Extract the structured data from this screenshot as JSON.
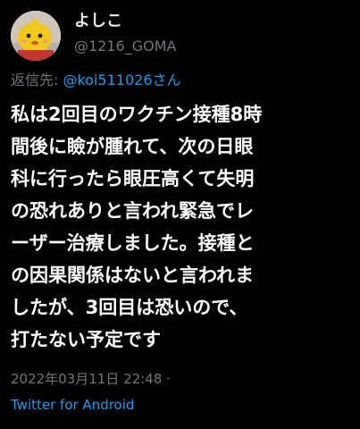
{
  "author": {
    "display_name": "よしこ",
    "handle": "@1216_GOMA",
    "avatar_icon": "yellow-character-avatar-icon"
  },
  "reply": {
    "prefix": "返信先: ",
    "target": "@koi511026さん"
  },
  "tweet": {
    "lines": [
      "私は2回目のワクチン接種8時",
      "間後に瞼が腫れて、次の日眼",
      "科に行ったら眼圧高くて失明",
      "の恐れありと言われ緊急でレ",
      "ーザー治療しました。接種と",
      "の因果関係はないと言われま",
      "したが、3回目は恐いので、",
      "打たない予定です"
    ]
  },
  "meta": {
    "timestamp": "2022年03月11日 22:48 ·",
    "source": "Twitter for Android"
  },
  "colors": {
    "background": "#000000",
    "text": "#ffffff",
    "muted": "#71767b",
    "accent": "#1d9bf0"
  }
}
